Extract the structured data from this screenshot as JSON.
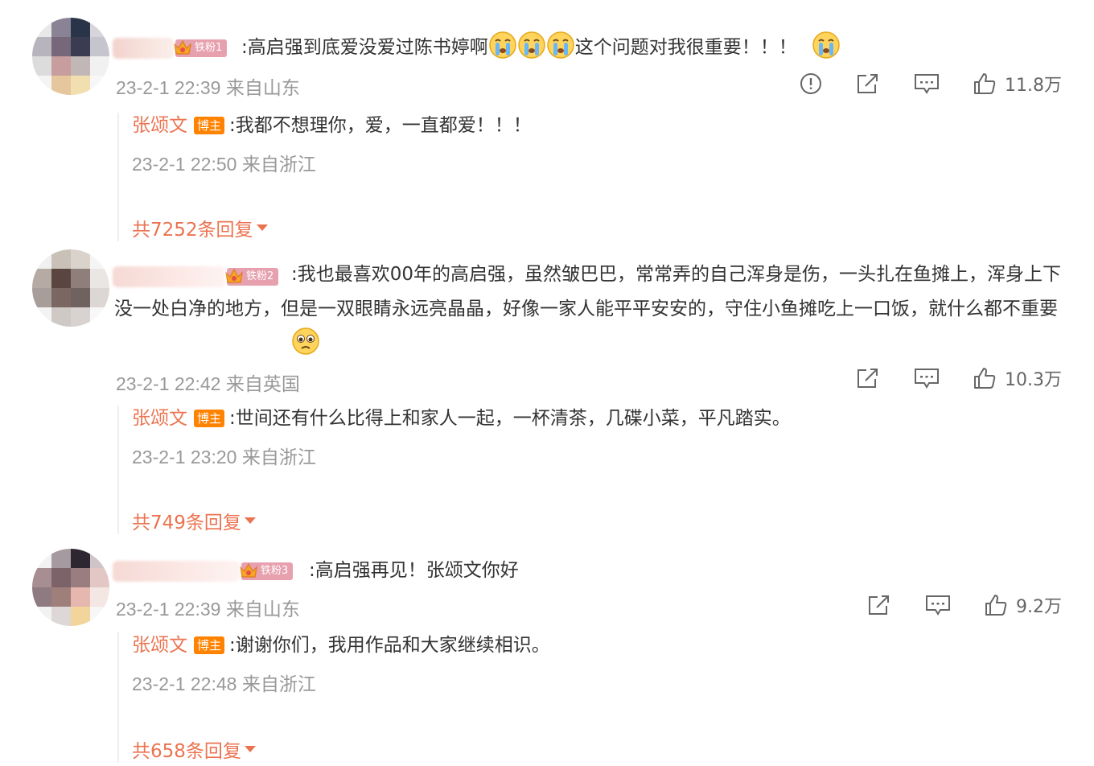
{
  "comments": [
    {
      "fan_badge": "铁粉1",
      "text_a": ":高启强到底爱没爱过陈书婷啊",
      "text_b": "这个问题对我很重要！！！",
      "time": "23-2-1 22:39",
      "location": "来自山东",
      "likes": "11.8万",
      "avatar_colors": [
        "#e8e8e8",
        "#8a8396",
        "#2a3448",
        "#d7d4dc",
        "#b7b4bd",
        "#77677a",
        "#3a3d52",
        "#c6c4cc",
        "#dcdcdc",
        "#c79d9d",
        "#c1b7b6",
        "#f1f1f1",
        "#f4f4f4",
        "#e6c69c",
        "#f2dfb0",
        "#f7f7f7"
      ],
      "reply": {
        "author": "张颂文",
        "badge": "博主",
        "text": ":我都不想理你，爱，一直都爱！！！",
        "time": "23-2-1 22:50",
        "location": "来自浙江",
        "more": "共7252条回复"
      }
    },
    {
      "fan_badge": "铁粉2",
      "text": ":我也最喜欢00年的高启强，虽然皱巴巴，常常弄的自己浑身是伤，一头扎在鱼摊上，浑身上下没一处白净的地方，但是一双眼睛永远亮晶晶，好像一家人能平平安安的，守住小鱼摊吃上一口饭，就什么都不重要",
      "time": "23-2-1 22:42",
      "location": "来自英国",
      "likes": "10.3万",
      "avatar_colors": [
        "#f0f0f0",
        "#c9c1b8",
        "#d9d3cc",
        "#f5f5f5",
        "#b5aba4",
        "#5a4541",
        "#8e7f7b",
        "#e9e6e3",
        "#a79d99",
        "#7b6762",
        "#6f625f",
        "#dcd7d4",
        "#f3f3f3",
        "#cfc9c6",
        "#d8d3d0",
        "#f8f8f8"
      ],
      "reply": {
        "author": "张颂文",
        "badge": "博主",
        "text": ":世间还有什么比得上和家人一起，一杯清茶，几碟小菜，平凡踏实。",
        "time": "23-2-1 23:20",
        "location": "来自浙江",
        "more": "共749条回复"
      }
    },
    {
      "fan_badge": "铁粉3",
      "text": ":高启强再见！张颂文你好",
      "time": "23-2-1 22:39",
      "location": "来自山东",
      "likes": "9.2万",
      "avatar_colors": [
        "#f2f2f2",
        "#a59aa0",
        "#2e2631",
        "#cfc5c8",
        "#a68e92",
        "#7c6369",
        "#9a7d7e",
        "#e2c7c5",
        "#8f7a82",
        "#9e7f79",
        "#e6b7ae",
        "#f3e6e3",
        "#f2f2f2",
        "#ddd7d8",
        "#f1d59b",
        "#f7f7f7"
      ],
      "reply": {
        "author": "张颂文",
        "badge": "博主",
        "text": ":谢谢你们，我用作品和大家继续相识。",
        "time": "23-2-1 22:48",
        "location": "来自浙江",
        "more": "共658条回复"
      }
    }
  ]
}
